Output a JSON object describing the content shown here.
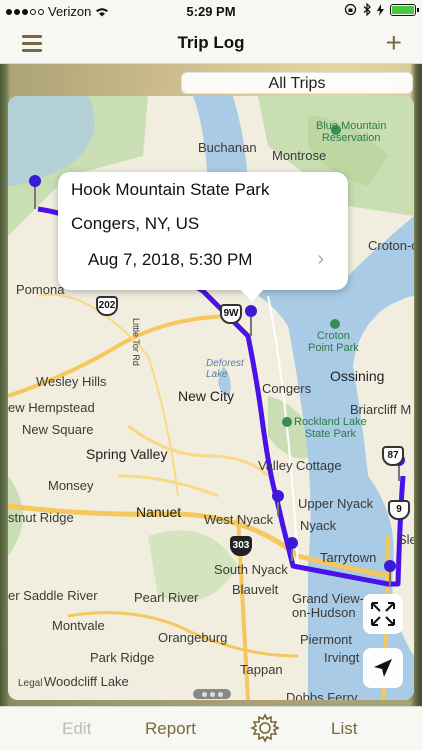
{
  "status_bar": {
    "carrier": "Verizon",
    "time": "5:29 PM"
  },
  "nav": {
    "title": "Trip Log",
    "menu_icon": "hamburger-icon",
    "add_icon": "plus-icon"
  },
  "segment": {
    "label": "All Trips"
  },
  "callout": {
    "place": "Hook Mountain State Park",
    "locality": "Congers, NY, US",
    "datetime": "Aug 7, 2018, 5:30 PM"
  },
  "map": {
    "labels": {
      "buchanan": "Buchanan",
      "montrose": "Montrose",
      "blue_mountain": "Blue Mountain\nReservation",
      "croton_on": "Croton-on-",
      "pomona": "Pomona",
      "croton_point": "Croton\nPoint Park",
      "deforest": "Deforest\nLake",
      "little_tor": "Little Tor Rd",
      "congers": "Congers",
      "ossining": "Ossining",
      "wesley_hills": "Wesley Hills",
      "new_city": "New City",
      "new_hempstead": "ew Hempstead",
      "briarcliff": "Briarcliff M",
      "new_square": "New Square",
      "rockland_lake": "Rockland Lake\nState Park",
      "spring_valley": "Spring Valley",
      "valley_cottage": "Valley Cottage",
      "monsey": "Monsey",
      "upper_nyack": "Upper Nyack",
      "chestnut_ridge": "stnut Ridge",
      "nanuet": "Nanuet",
      "west_nyack": "West Nyack",
      "nyack": "Nyack",
      "sle": "Sle",
      "tarrytown": "Tarrytown",
      "south_nyack": "South Nyack",
      "blauvelt": "Blauvelt",
      "saddle_river": "er Saddle River",
      "pearl_river": "Pearl River",
      "grand_view": "Grand View-\non-Hudson",
      "montvale": "Montvale",
      "orangeburg": "Orangeburg",
      "piermont": "Piermont",
      "park_ridge": "Park Ridge",
      "irvingt": "Irvingt",
      "woodcliff_lake": "Woodcliff Lake",
      "tappan": "Tappan",
      "dobbs_ferry": "Dobbs Ferry",
      "route_202": "202",
      "route_9w": "9W",
      "route_303": "303",
      "route_87": "87",
      "route_9": "9",
      "legal": "Legal"
    },
    "expand_icon": "expand-arrows-icon",
    "locate_icon": "location-arrow-icon",
    "route_color": "#4b12e8",
    "pin_color": "#3a1ad6"
  },
  "tabs": {
    "edit": "Edit",
    "report": "Report",
    "settings_icon": "gear-icon",
    "list": "List"
  },
  "colors": {
    "accent": "#7b6a3c",
    "water": "#a9cbe6",
    "park": "#c8dfb4"
  }
}
